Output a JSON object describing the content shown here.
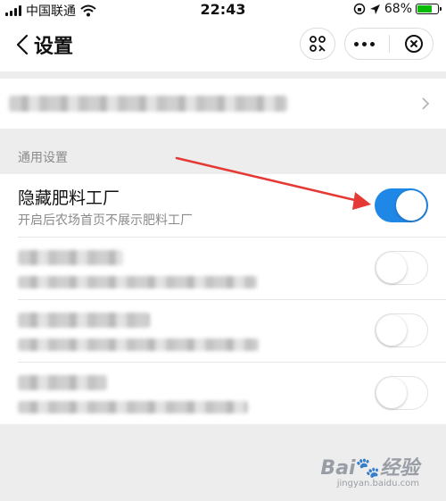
{
  "status_bar": {
    "carrier": "中国联通",
    "time": "22:43",
    "battery": "68%"
  },
  "nav": {
    "title": "设置"
  },
  "section": {
    "label": "通用设置"
  },
  "settings": [
    {
      "title": "隐藏肥料工厂",
      "subtitle": "开启后农场首页不展示肥料工厂",
      "enabled": true
    },
    {
      "title": "",
      "subtitle": "",
      "enabled": false
    },
    {
      "title": "",
      "subtitle": "",
      "enabled": false
    },
    {
      "title": "",
      "subtitle": "",
      "enabled": false
    }
  ],
  "colors": {
    "toggle_on": "#1f87e6",
    "arrow": "#e53935"
  },
  "icons": [
    "signal-icon",
    "wifi-icon",
    "location-icon",
    "back-icon",
    "scan-icon",
    "more-icon",
    "close-icon",
    "chevron-right-icon"
  ]
}
